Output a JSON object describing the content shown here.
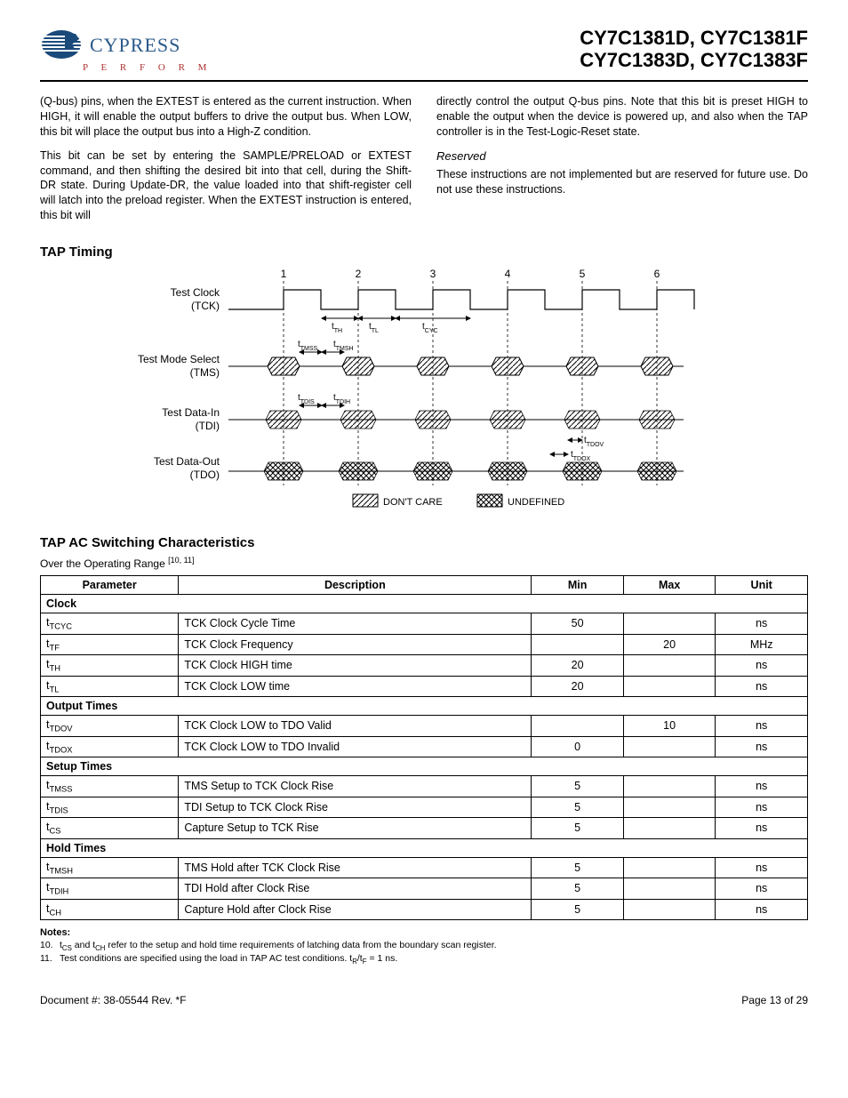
{
  "header": {
    "logo_name": "CYPRESS",
    "logo_tag": "P E R F O R M",
    "part_line1": "CY7C1381D, CY7C1381F",
    "part_line2": "CY7C1383D, CY7C1383F"
  },
  "body": {
    "left_p1": "(Q-bus) pins, when the EXTEST is entered as the current instruction. When HIGH, it will enable the output buffers to drive the output bus. When LOW, this bit will place the output bus into a High-Z condition.",
    "left_p2": "This bit can be set by entering the SAMPLE/PRELOAD or EXTEST command, and then shifting the desired bit into that cell, during the Shift-DR state. During Update-DR, the value loaded into that shift-register cell will latch into the preload register. When the EXTEST instruction is entered, this bit will",
    "right_p1": "directly control the output Q-bus pins. Note that this bit is preset HIGH to enable the output when the device is powered up, and also when the TAP controller is in the Test-Logic-Reset state.",
    "reserved_hd": "Reserved",
    "right_p2": "These instructions are not implemented but are reserved for future use. Do not use these instructions."
  },
  "timing": {
    "title": "TAP Timing",
    "cycles": [
      "1",
      "2",
      "3",
      "4",
      "5",
      "6"
    ],
    "signals": {
      "tck": {
        "label1": "Test Clock",
        "label2": "(TCK)"
      },
      "tms": {
        "label1": "Test Mode Select",
        "label2": "(TMS)"
      },
      "tdi": {
        "label1": "Test Data-In",
        "label2": "(TDI)"
      },
      "tdo": {
        "label1": "Test Data-Out",
        "label2": "(TDO)"
      }
    },
    "annot": {
      "tth": "t",
      "tth_sub": "TH",
      "ttl": "t",
      "ttl_sub": "TL",
      "tcyc": "t",
      "tcyc_sub": "CYC",
      "ttmss": "t",
      "ttmss_sub": "TMSS",
      "ttmsh": "t",
      "ttmsh_sub": "TMSH",
      "ttdis": "t",
      "ttdis_sub": "TDIS",
      "ttdih": "t",
      "ttdih_sub": "TDIH",
      "ttdov": "t",
      "ttdov_sub": "TDOV",
      "ttdox": "t",
      "ttdox_sub": "TDOX"
    },
    "legend": {
      "dontcare": "DON'T CARE",
      "undefined": "UNDEFINED"
    }
  },
  "tap_ac": {
    "title": "TAP AC Switching Characteristics",
    "subtitle_a": "Over the Operating Range ",
    "subtitle_b": "[10, 11]",
    "cols": {
      "param": "Parameter",
      "desc": "Description",
      "min": "Min",
      "max": "Max",
      "unit": "Unit"
    },
    "sections": [
      {
        "name": "Clock",
        "rows": [
          {
            "p": "t",
            "s": "TCYC",
            "d": "TCK Clock Cycle Time",
            "min": "50",
            "max": "",
            "u": "ns"
          },
          {
            "p": "t",
            "s": "TF",
            "d": "TCK Clock Frequency",
            "min": "",
            "max": "20",
            "u": "MHz"
          },
          {
            "p": "t",
            "s": "TH",
            "d": "TCK Clock HIGH time",
            "min": "20",
            "max": "",
            "u": "ns"
          },
          {
            "p": "t",
            "s": "TL",
            "d": "TCK Clock LOW time",
            "min": "20",
            "max": "",
            "u": "ns"
          }
        ]
      },
      {
        "name": "Output Times",
        "rows": [
          {
            "p": "t",
            "s": "TDOV",
            "d": "TCK Clock LOW to TDO Valid",
            "min": "",
            "max": "10",
            "u": "ns"
          },
          {
            "p": "t",
            "s": "TDOX",
            "d": "TCK Clock LOW to TDO Invalid",
            "min": "0",
            "max": "",
            "u": "ns"
          }
        ]
      },
      {
        "name": "Setup Times",
        "rows": [
          {
            "p": "t",
            "s": "TMSS",
            "d": "TMS Setup to TCK Clock Rise",
            "min": "5",
            "max": "",
            "u": "ns"
          },
          {
            "p": "t",
            "s": "TDIS",
            "d": "TDI Setup to TCK Clock Rise",
            "min": "5",
            "max": "",
            "u": "ns"
          },
          {
            "p": "t",
            "s": "CS",
            "d": "Capture Setup to TCK Rise",
            "min": "5",
            "max": "",
            "u": "ns"
          }
        ]
      },
      {
        "name": "Hold Times",
        "rows": [
          {
            "p": "t",
            "s": "TMSH",
            "d": "TMS Hold after TCK Clock Rise",
            "min": "5",
            "max": "",
            "u": "ns"
          },
          {
            "p": "t",
            "s": "TDIH",
            "d": "TDI Hold after Clock Rise",
            "min": "5",
            "max": "",
            "u": "ns"
          },
          {
            "p": "t",
            "s": "CH",
            "d": "Capture Hold after Clock Rise",
            "min": "5",
            "max": "",
            "u": "ns"
          }
        ]
      }
    ]
  },
  "notes": {
    "hd": "Notes:",
    "items": [
      {
        "n": "10.",
        "t_a": "t",
        "t_as": "CS",
        "t_mid": " and t",
        "t_bs": "CH",
        "t_end": " refer to the setup and hold time requirements of latching data from the boundary scan register."
      },
      {
        "n": "11.",
        "full": "Test conditions are specified using the load in TAP AC test conditions. t",
        "r": "R",
        "mid": "/t",
        "f": "F",
        "end": " = 1 ns."
      }
    ]
  },
  "footer": {
    "doc": "Document #: 38-05544 Rev. *F",
    "page": "Page 13 of 29"
  }
}
